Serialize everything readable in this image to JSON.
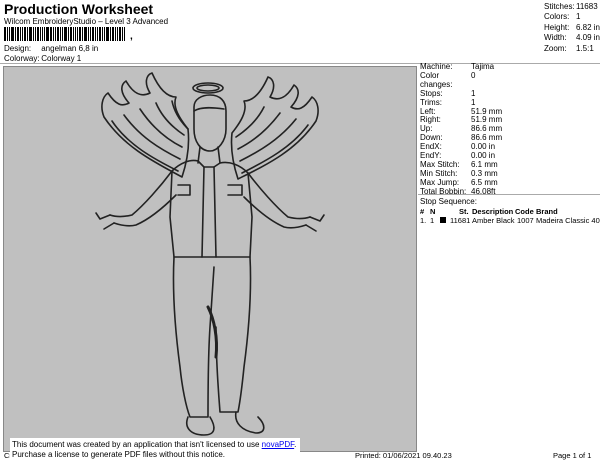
{
  "header": {
    "title": "Production Worksheet",
    "subtitle": "Wilcom EmbroideryStudio – Level 3 Advanced",
    "barcode_suffix": ","
  },
  "meta": {
    "design_label": "Design:",
    "design_value": "angelman 6,8 in",
    "colorway_label": "Colorway:",
    "colorway_value": "Colorway 1"
  },
  "stats": [
    {
      "label": "Stitches:",
      "value": "11683"
    },
    {
      "label": "Colors:",
      "value": "1"
    },
    {
      "label": "Height:",
      "value": "6.82 in"
    },
    {
      "label": "Width:",
      "value": "4.09 in"
    },
    {
      "label": "Zoom:",
      "value": "1.5:1"
    }
  ],
  "machine_info": [
    {
      "label": "Machine:",
      "value": "Tajima"
    },
    {
      "label": "Color changes:",
      "value": "0"
    },
    {
      "label": "Stops:",
      "value": "1"
    },
    {
      "label": "Trims:",
      "value": "1"
    },
    {
      "label": "Left:",
      "value": "51.9 mm"
    },
    {
      "label": "Right:",
      "value": "51.9 mm"
    },
    {
      "label": "Up:",
      "value": "86.6 mm"
    },
    {
      "label": "Down:",
      "value": "86.6 mm"
    },
    {
      "label": "EndX:",
      "value": "0.00 in"
    },
    {
      "label": "EndY:",
      "value": "0.00 in"
    },
    {
      "label": "Max Stitch:",
      "value": "6.1 mm"
    },
    {
      "label": "Min Stitch:",
      "value": "0.3 mm"
    },
    {
      "label": "Max Jump:",
      "value": "6.5 mm"
    },
    {
      "label": "Total Bobbin:",
      "value": "46.08ft"
    }
  ],
  "stop_sequence": {
    "title": "Stop Sequence:",
    "headers": {
      "num": "#",
      "n": "N",
      "st": "St.",
      "description": "Description",
      "code": "Code",
      "brand": "Brand"
    },
    "rows": [
      {
        "num": "1.",
        "n": "1",
        "st": "11681",
        "description": "Amber Black",
        "code": "1007",
        "brand": "Madeira Classic 40",
        "color": "#000000"
      }
    ]
  },
  "notice": {
    "line1_prefix": "This document was created by an application that isn't licensed to use ",
    "link": "novaPDF",
    "line1_suffix": ".",
    "line2": "Purchase a license to generate PDF files without this notice."
  },
  "footer": {
    "left": "Cr",
    "printed": "Printed: 01/06/2021 09.40.23",
    "page": "Page 1 of 1"
  },
  "design_bg": "#c0c0c0"
}
